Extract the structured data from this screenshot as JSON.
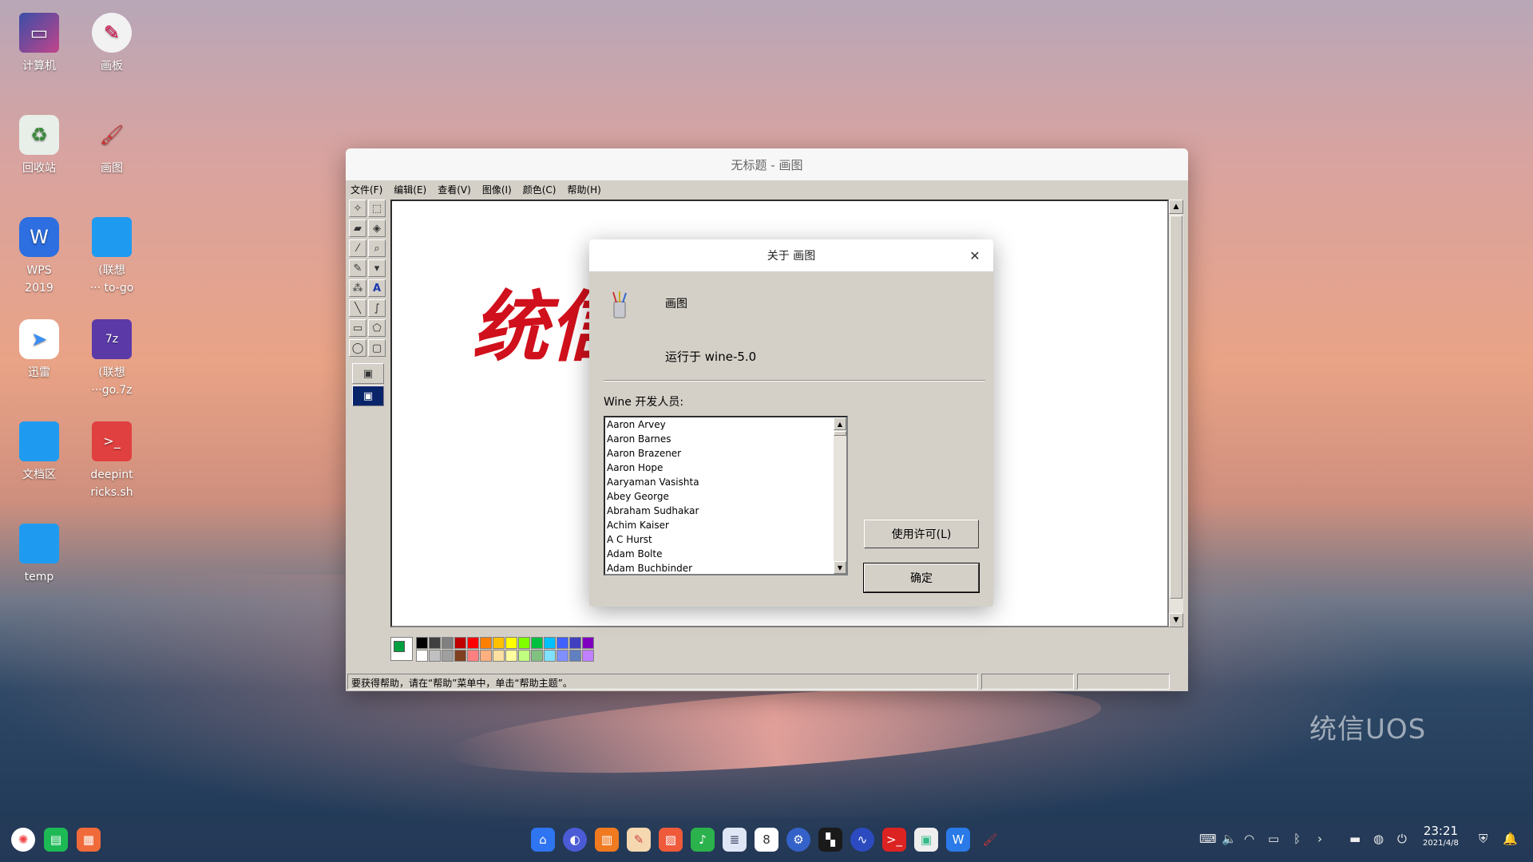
{
  "desktop": {
    "icons": [
      {
        "label": "计算机"
      },
      {
        "label": "画板"
      },
      {
        "label": "回收站"
      },
      {
        "label": "画图"
      },
      {
        "label": "WPS\n2019"
      },
      {
        "label": "(联想\n··· to-go"
      },
      {
        "label": "迅雷"
      },
      {
        "label": "(联想\n···go.7z"
      },
      {
        "label": "文档区"
      },
      {
        "label": "deepint\nricks.sh"
      },
      {
        "label": "temp"
      }
    ],
    "watermark": "统信UOS"
  },
  "window": {
    "title": "无标题 - 画图",
    "menu": [
      "文件(F)",
      "编辑(E)",
      "查看(V)",
      "图像(I)",
      "颜色(C)",
      "帮助(H)"
    ],
    "canvas_text": "统信",
    "status": "要获得帮助，请在“帮助”菜单中，单击“帮助主题”。"
  },
  "palette": {
    "top": [
      "#000000",
      "#404040",
      "#808080",
      "#c00000",
      "#ff0000",
      "#ff8000",
      "#ffc000",
      "#ffff00",
      "#80ff00",
      "#00c040",
      "#00c0ff",
      "#4060ff",
      "#4040c0",
      "#8000c0"
    ],
    "bottom": [
      "#ffffff",
      "#c0c0c0",
      "#a0a0a0",
      "#804020",
      "#ff8080",
      "#ffb080",
      "#ffe0a0",
      "#ffffa0",
      "#c0ff80",
      "#80c080",
      "#80e0ff",
      "#8090ff",
      "#6080c0",
      "#c080ff"
    ],
    "fg": "#00a040",
    "bg": "#ffffff"
  },
  "about": {
    "title": "关于 画图",
    "app_name": "画图",
    "running_on": "运行于 wine-5.0",
    "devs_label": "Wine 开发人员:",
    "developers": [
      "Aaron Arvey",
      "Aaron Barnes",
      "Aaron Brazener",
      "Aaron Hope",
      "Aaryaman Vasishta",
      "Abey George",
      "Abraham Sudhakar",
      "Achim Kaiser",
      "A C Hurst",
      "Adam Bolte",
      "Adam Buchbinder"
    ],
    "license_button": "使用许可(L)",
    "ok_button": "确定"
  },
  "taskbar": {
    "time": "23:21",
    "date": "2021/4/8"
  }
}
